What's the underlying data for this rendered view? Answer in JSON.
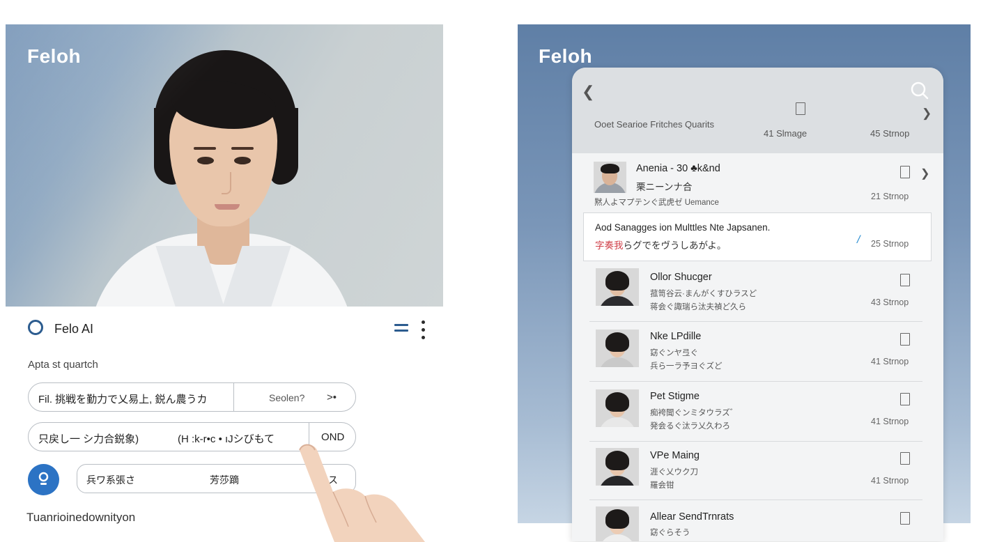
{
  "left": {
    "brand": "Feloh",
    "app_name": "Felo AI",
    "section_label": "Apta st quartch",
    "field1": {
      "text": "Fil. 挑戦を勤力で乂易上, 鋭ん農うカ",
      "select": "Seolen?",
      "arrow": ">•"
    },
    "field2": {
      "text": "只戻し一 シ力合鋭象)",
      "mid": "(H :k-r•c • ıJシびもて",
      "button": "OND"
    },
    "field3": {
      "a": "兵ワ系張さ",
      "b": "芳莎蹢",
      "c": "ス"
    },
    "footer": "Tuanrioinedownityon"
  },
  "right": {
    "brand": "Feloh",
    "header": {
      "title": "Ooet Searioe Fritches Quarits",
      "stat1": "41 Slmage",
      "stat2": "45 Strnop"
    },
    "items": [
      {
        "name": "Anenia - 30 ♣k&nd",
        "sub1": "栗ニーンナ合",
        "sub2": "黙人よマプテンぐ武虎ゼ  Uemance",
        "stat": "21 Strnop",
        "skin": "#d9b398",
        "shirt": "#9aa0a8"
      },
      {
        "name": "Ollor Shucger",
        "sub1": "菰笥谷云·まんがくすひラスど",
        "sub2": "蒋会ぐ諏瑞ら汰夫禎ど久ら",
        "stat": "43 Strnop",
        "skin": "#e3bfa4",
        "shirt": "#2b2b2e"
      },
      {
        "name": "Nke LPdille",
        "sub1": "窈ぐンヤ弖ぐ",
        "sub2": "兵ら一ラ予ヨぐズど",
        "stat": "41 Strnop",
        "skin": "#e6c3a9",
        "shirt": "#c9c9c9"
      },
      {
        "name": "Pet Stigme",
        "sub1": "痴袴聞ぐンミタウラズ゛",
        "sub2": "発会るぐ汰ラ乂久わろ",
        "stat": "41 Strnop",
        "skin": "#e6c4aa",
        "shirt": "#e8e8e8"
      },
      {
        "name": "VPe Maing",
        "sub1": "涯ぐ乂ウク刀",
        "sub2": "羅会钳",
        "stat": "41 Strnop",
        "skin": "#e8c6ac",
        "shirt": "#262628"
      },
      {
        "name": "Allear SendTrnrats",
        "sub1": "窈ぐらそう",
        "sub2": "",
        "stat": "",
        "skin": "#ecccb4",
        "shirt": "#eeeeee"
      }
    ],
    "card": {
      "line1": "Aod Sanagges ion Multtles Nte Japsanen.",
      "line2_highlight": "字奏我",
      "line2_rest": "らグでをヴうしあがよ。",
      "stat": "25 Strnop"
    }
  },
  "icons": [
    "ring-icon",
    "menu-icon",
    "kebab-icon",
    "pin-icon",
    "back-icon",
    "search-icon",
    "bookmark-icon",
    "chevron-right-icon"
  ],
  "colors": {
    "accent": "#2c5c8f",
    "pin_button": "#2c73c4",
    "highlight": "#d0404a",
    "link": "#2a8dd2"
  }
}
